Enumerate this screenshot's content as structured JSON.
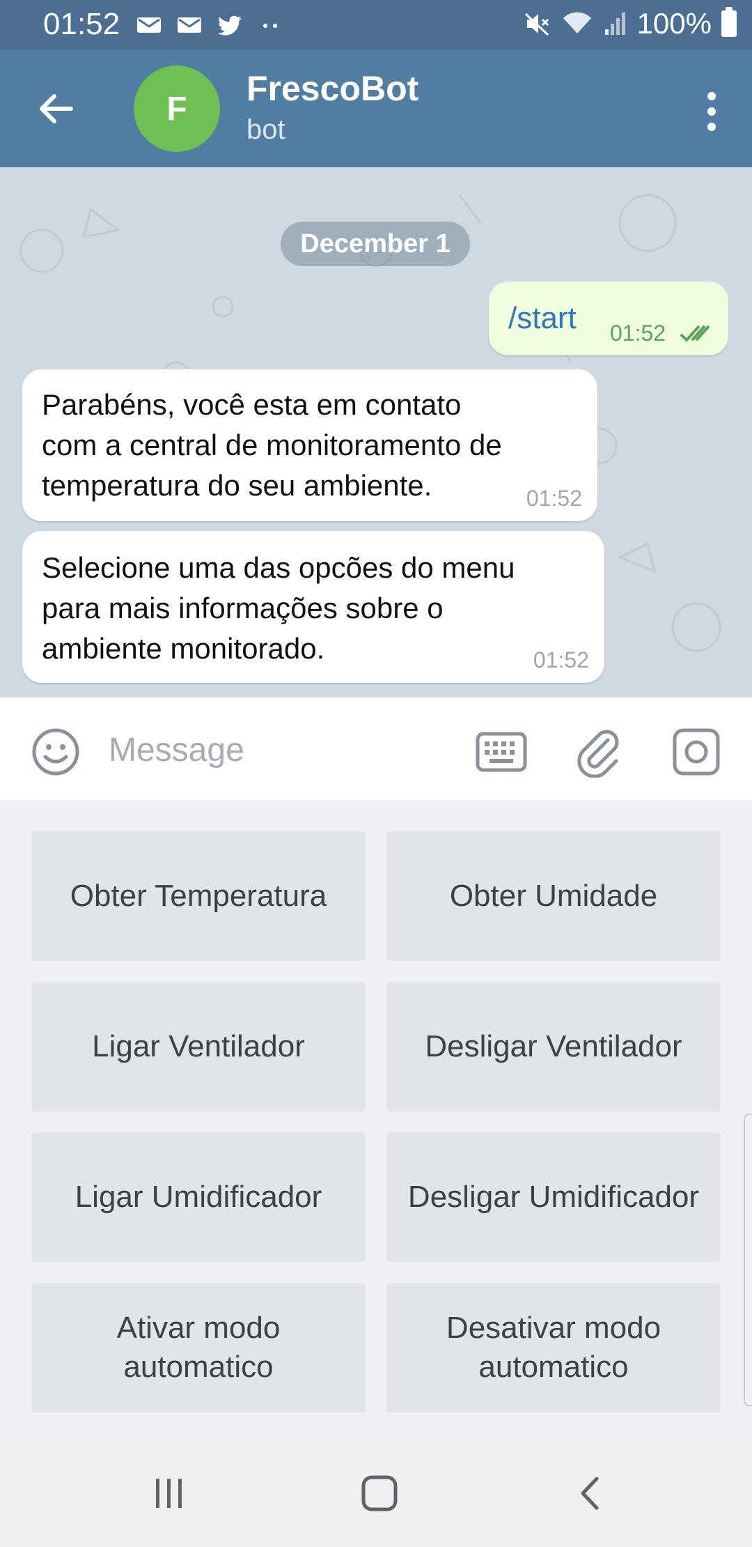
{
  "status_bar": {
    "time": "01:52",
    "battery": "100%",
    "icons_left": [
      "mail-icon",
      "mail-icon",
      "twitter-icon",
      "more-dots-icon"
    ],
    "icons_right": [
      "mute-icon",
      "wifi-icon",
      "signal-icon",
      "battery-icon"
    ]
  },
  "header": {
    "avatar_letter": "F",
    "avatar_color": "#6fc052",
    "title": "FrescoBot",
    "subtitle": "bot",
    "header_color": "#517da2"
  },
  "chat": {
    "date_label": "December 1",
    "messages": [
      {
        "direction": "out",
        "text": "/start",
        "time": "01:52",
        "status": "read"
      },
      {
        "direction": "in",
        "lines": [
          "Parabéns, você esta em contato",
          "com a central de monitoramento de",
          "temperatura do seu ambiente."
        ],
        "time": "01:52"
      },
      {
        "direction": "in",
        "lines": [
          "Selecione uma das opcões do menu",
          "para mais informações sobre o",
          "ambiente monitorado."
        ],
        "time": "01:52"
      }
    ]
  },
  "input": {
    "placeholder": "Message",
    "icons": [
      "emoji-icon",
      "keyboard-icon",
      "attach-icon",
      "camera-icon"
    ]
  },
  "keyboard": {
    "buttons": [
      "Obter Temperatura",
      "Obter Umidade",
      "Ligar Ventilador",
      "Desligar Ventilador",
      "Ligar Umidificador",
      "Desligar Umidificador",
      "Ativar modo automatico",
      "Desativar modo automatico"
    ]
  },
  "nav": {
    "buttons": [
      "recents-icon",
      "home-icon",
      "back-icon"
    ]
  }
}
